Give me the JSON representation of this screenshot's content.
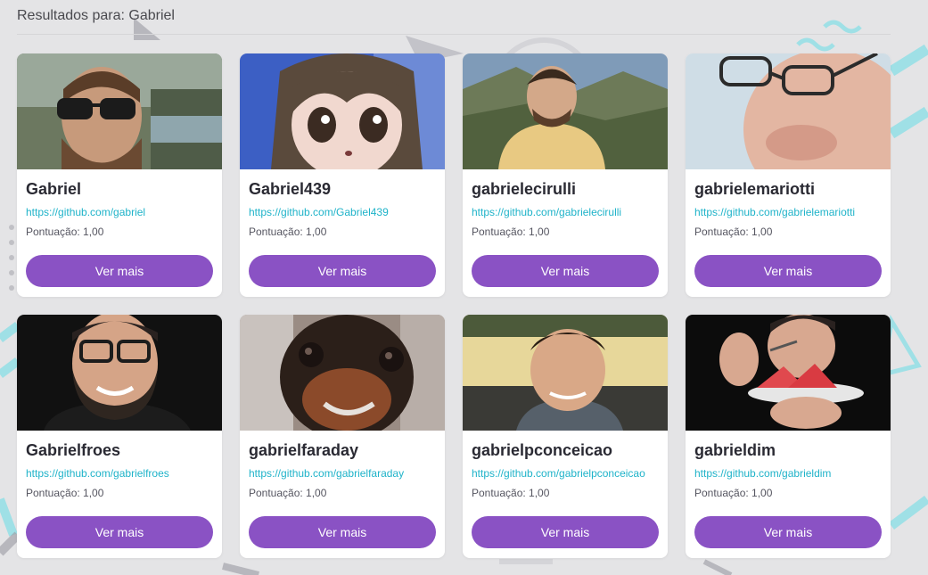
{
  "results": {
    "title": "Resultados para: Gabriel"
  },
  "cards": [
    {
      "name": "Gabriel",
      "url": "https://github.com/gabriel",
      "score": "Pontuação: 1,00",
      "button": "Ver mais"
    },
    {
      "name": "Gabriel439",
      "url": "https://github.com/Gabriel439",
      "score": "Pontuação: 1,00",
      "button": "Ver mais"
    },
    {
      "name": "gabrielecirulli",
      "url": "https://github.com/gabrielecirulli",
      "score": "Pontuação: 1,00",
      "button": "Ver mais"
    },
    {
      "name": "gabrielemariotti",
      "url": "https://github.com/gabrielemariotti",
      "score": "Pontuação: 1,00",
      "button": "Ver mais"
    },
    {
      "name": "Gabrielfroes",
      "url": "https://github.com/gabrielfroes",
      "score": "Pontuação: 1,00",
      "button": "Ver mais"
    },
    {
      "name": "gabrielfaraday",
      "url": "https://github.com/gabrielfaraday",
      "score": "Pontuação: 1,00",
      "button": "Ver mais"
    },
    {
      "name": "gabrielpconceicao",
      "url": "https://github.com/gabrielpconceicao",
      "score": "Pontuação: 1,00",
      "button": "Ver mais"
    },
    {
      "name": "gabrieldim",
      "url": "https://github.com/gabrieldim",
      "score": "Pontuação: 1,00",
      "button": "Ver mais"
    }
  ],
  "colors": {
    "background": "#e4e4e6",
    "accent": "#8a52c4",
    "link": "#1fb3c9"
  }
}
